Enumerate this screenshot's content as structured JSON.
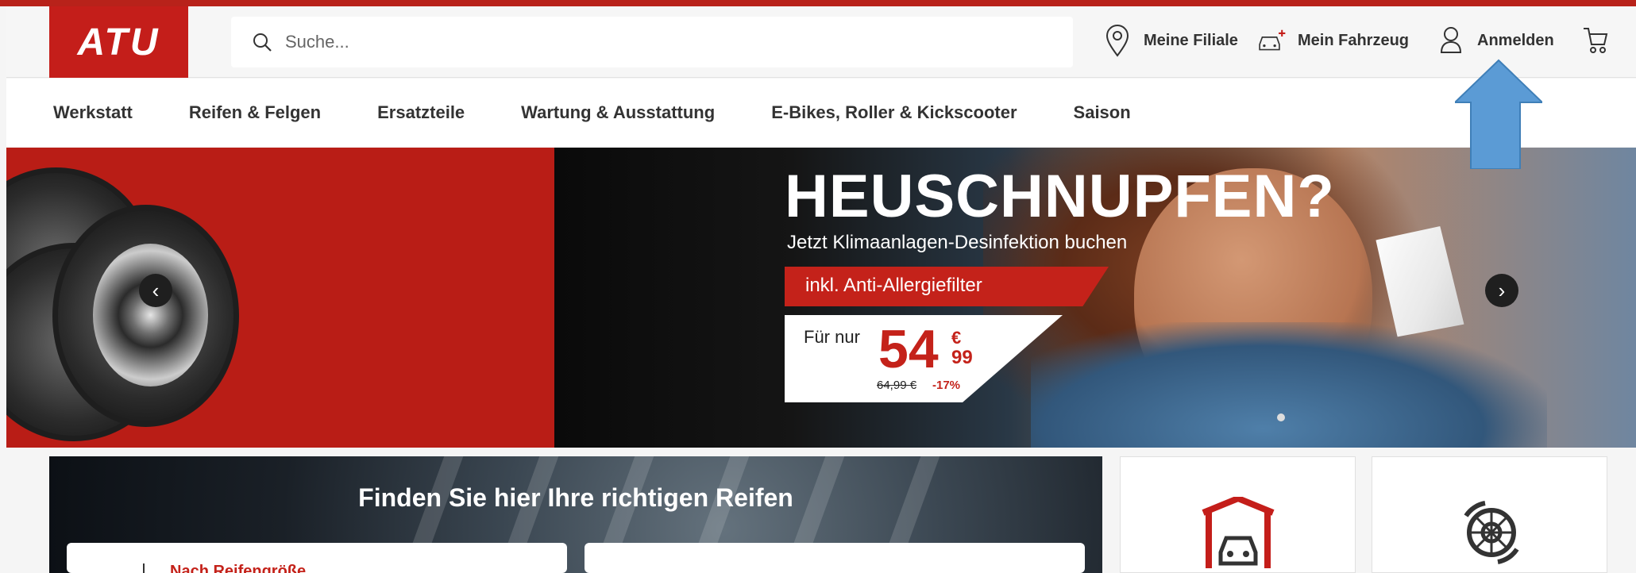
{
  "header": {
    "logo_text": "ATU",
    "search_placeholder": "Suche...",
    "store_label": "Meine Filiale",
    "vehicle_label": "Mein Fahrzeug",
    "login_label": "Anmelden",
    "cart_icon": "cart-icon"
  },
  "menu": [
    "Werkstatt",
    "Reifen & Felgen",
    "Ersatzteile",
    "Wartung & Ausstattung",
    "E-Bikes, Roller & Kickscooter",
    "Saison"
  ],
  "hero": {
    "headline": "HEUSCHNUPFEN?",
    "subline": "Jetzt Klimaanlagen-Desinfektion buchen",
    "promo": "inkl. Anti-Allergiefilter",
    "price_prefix": "Für nur",
    "price_main": "54",
    "price_currency": "€",
    "price_cents": "99",
    "old_price": "64,99 €",
    "discount": "-17%"
  },
  "tires_section": {
    "title": "Finden Sie hier Ihre richtigen Reifen",
    "card_text": "Nach Reifengröße"
  },
  "colors": {
    "brand_red": "#c41e1a",
    "accent_blue": "#5b9bd5"
  }
}
